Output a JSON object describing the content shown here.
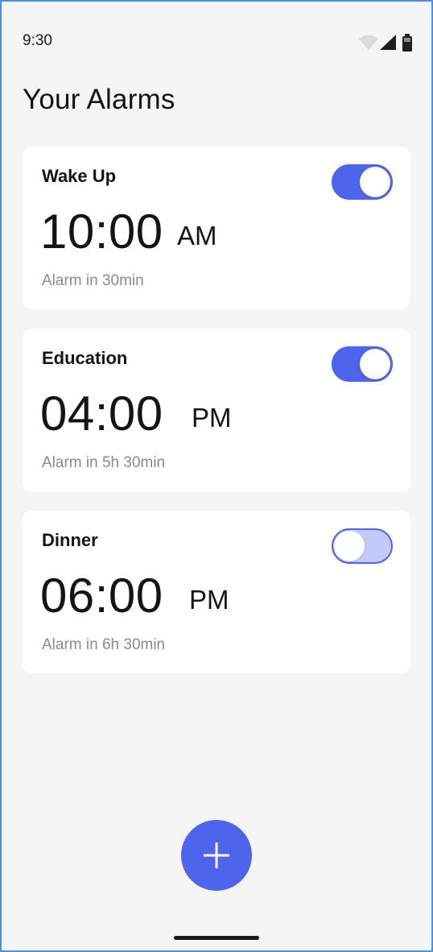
{
  "status_bar": {
    "time": "9:30",
    "icons": [
      "wifi-icon",
      "cellular-signal-icon",
      "battery-icon"
    ]
  },
  "page": {
    "title": "Your Alarms"
  },
  "alarms": [
    {
      "label": "Wake Up",
      "time": "10:00",
      "period": "AM",
      "subtitle": "Alarm in 30min",
      "enabled": true
    },
    {
      "label": "Education",
      "time": "04:00",
      "period": "PM",
      "subtitle": "Alarm in 5h 30min",
      "enabled": true
    },
    {
      "label": "Dinner",
      "time": "06:00",
      "period": "PM",
      "subtitle": "Alarm in 6h 30min",
      "enabled": false
    }
  ],
  "fab": {
    "icon": "plus-icon"
  },
  "colors": {
    "accent": "#4e64ed",
    "toggle_off": "#c3c9f8",
    "background": "#f5f5f5",
    "card": "#ffffff",
    "subtitle_text": "#8a8a8a"
  }
}
